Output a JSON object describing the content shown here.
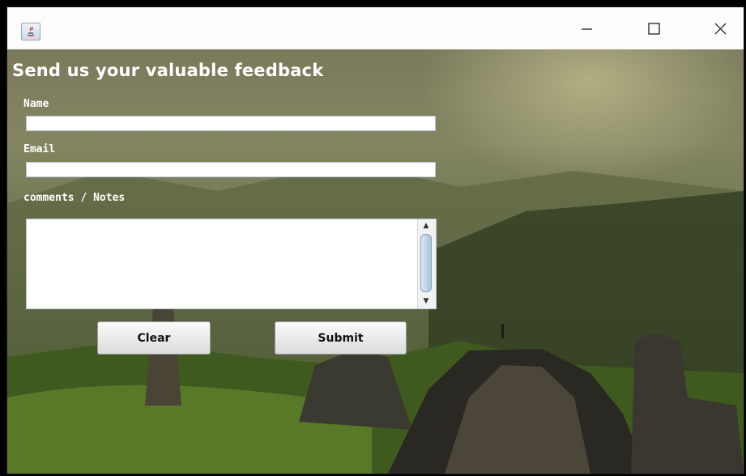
{
  "window": {
    "title": ""
  },
  "titlebar": {
    "icon": "java-icon",
    "min": "minimize-icon",
    "max": "maximize-icon",
    "close": "close-icon"
  },
  "form": {
    "heading": "Send us your valuable feedback",
    "name_label": "Name",
    "name_value": "",
    "email_label": "Email",
    "email_value": "",
    "notes_label": "comments / Notes",
    "notes_value": "",
    "clear_label": "Clear",
    "submit_label": "Submit"
  },
  "colors": {
    "label_text": "#ffffff",
    "field_border": "#b7c7d8",
    "button_face": "#e8e8e8"
  }
}
